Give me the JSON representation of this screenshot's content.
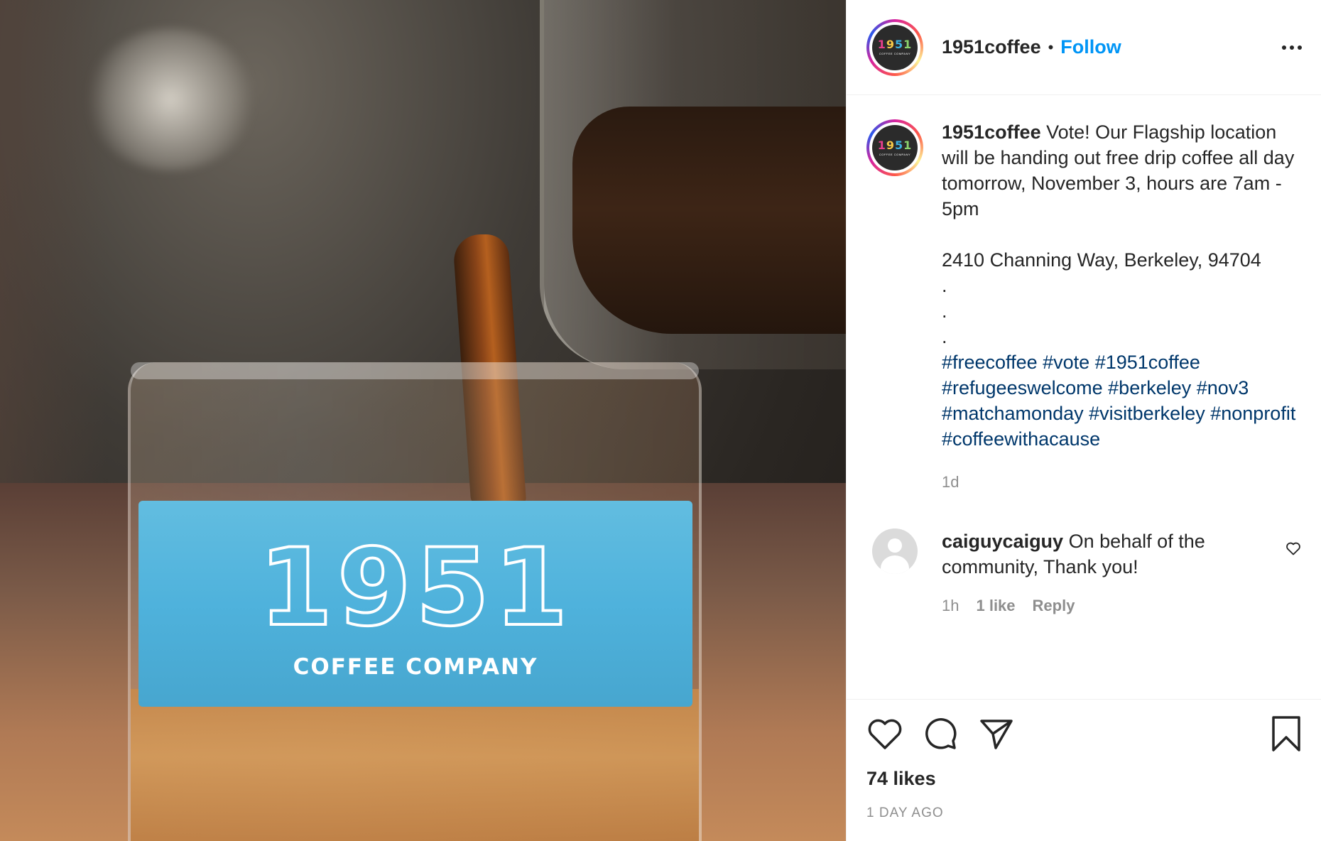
{
  "photo": {
    "sleeve_number": "1951",
    "sleeve_text": "COFFEE COMPANY"
  },
  "header": {
    "avatar_text": "1951",
    "avatar_subtext": "COFFEE COMPANY",
    "username": "1951coffee",
    "separator": "•",
    "follow_label": "Follow",
    "more_icon": "more-options-icon"
  },
  "caption": {
    "username": "1951coffee",
    "text": "Vote! Our Flagship location will be handing out free drip coffee all day tomorrow, November 3, hours are 7am - 5pm\n\n2410 Channing Way, Berkeley, 94704\n.\n.\n.",
    "hashtags": [
      "#freecoffee",
      "#vote",
      "#1951coffee",
      "#refugeeswelcome",
      "#berkeley",
      "#nov3",
      "#matchamonday",
      "#visitberkeley",
      "#nonprofit",
      "#coffeewithacause"
    ],
    "time": "1d"
  },
  "comment": {
    "username": "caiguycaiguy",
    "text": "On behalf of the community, Thank you!",
    "time": "1h",
    "likes": "1 like",
    "reply_label": "Reply"
  },
  "actions": {
    "likes": "74 likes",
    "date": "1 DAY AGO"
  },
  "colors": {
    "link_blue": "#0095f6",
    "hashtag_blue": "#00376b",
    "muted": "#8e8e8e",
    "sleeve_blue": "#4fb2dc"
  }
}
